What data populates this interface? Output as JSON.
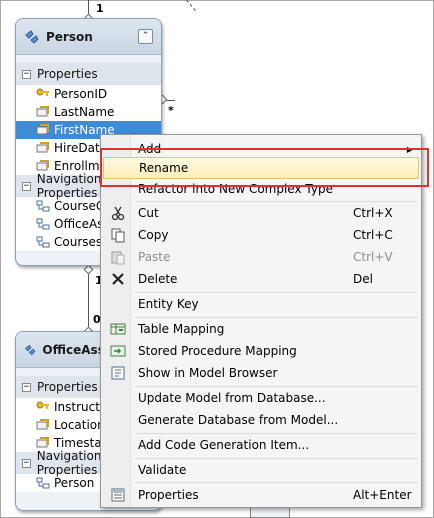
{
  "diagram": {
    "multiplicities": {
      "top_one": "1",
      "right_star": "*",
      "mid_one": "1",
      "lower_zero_one": "0"
    }
  },
  "entities": [
    {
      "title": "Person",
      "collapse_glyph": "⌃",
      "sections": [
        {
          "name": "Properties",
          "toggle": "−",
          "items": [
            {
              "label": "PersonID",
              "icon": "key-property-icon"
            },
            {
              "label": "LastName",
              "icon": "property-icon"
            },
            {
              "label": "FirstName",
              "icon": "property-icon",
              "selected": true
            },
            {
              "label": "HireDate",
              "icon": "property-icon"
            },
            {
              "label": "EnrollmentDate",
              "icon": "property-icon"
            }
          ]
        },
        {
          "name": "Navigation Properties",
          "toggle": "−",
          "items": [
            {
              "label": "CourseGrades",
              "icon": "navigation-property-icon"
            },
            {
              "label": "OfficeAssignment",
              "icon": "navigation-property-icon"
            },
            {
              "label": "Courses",
              "icon": "navigation-property-icon"
            }
          ]
        }
      ]
    },
    {
      "title": "OfficeAssignment",
      "sections": [
        {
          "name": "Properties",
          "toggle": "−",
          "items": [
            {
              "label": "InstructorID",
              "icon": "key-property-icon"
            },
            {
              "label": "Location",
              "icon": "property-icon"
            },
            {
              "label": "Timestamp",
              "icon": "property-icon"
            }
          ]
        },
        {
          "name": "Navigation Properties",
          "toggle": "−",
          "items": [
            {
              "label": "Person",
              "icon": "navigation-property-icon"
            }
          ]
        }
      ]
    }
  ],
  "context_menu": {
    "items": [
      {
        "label": "Add",
        "submenu": true
      },
      {
        "label": "Rename",
        "highlighted": true
      },
      {
        "label": "Refactor into New Complex Type"
      },
      {
        "label": "Cut",
        "shortcut": "Ctrl+X",
        "icon": "scissors-icon"
      },
      {
        "label": "Copy",
        "shortcut": "Ctrl+C",
        "icon": "copy-icon"
      },
      {
        "label": "Paste",
        "shortcut": "Ctrl+V",
        "icon": "paste-icon",
        "disabled": true
      },
      {
        "label": "Delete",
        "shortcut": "Del",
        "icon": "delete-icon"
      },
      {
        "label": "Entity Key"
      },
      {
        "label": "Table Mapping",
        "icon": "table-mapping-icon"
      },
      {
        "label": "Stored Procedure Mapping",
        "icon": "stored-procedure-mapping-icon"
      },
      {
        "label": "Show in Model Browser",
        "icon": "model-browser-icon"
      },
      {
        "label": "Update Model from Database..."
      },
      {
        "label": "Generate Database from Model..."
      },
      {
        "label": "Add Code Generation Item..."
      },
      {
        "label": "Validate"
      },
      {
        "label": "Properties",
        "shortcut": "Alt+Enter",
        "icon": "properties-icon"
      }
    ]
  },
  "colors": {
    "selection": "#3f8bd6",
    "highlight_border": "#e4c36a",
    "callout_red": "#e03030",
    "entity_header": "#c9d5e2"
  }
}
